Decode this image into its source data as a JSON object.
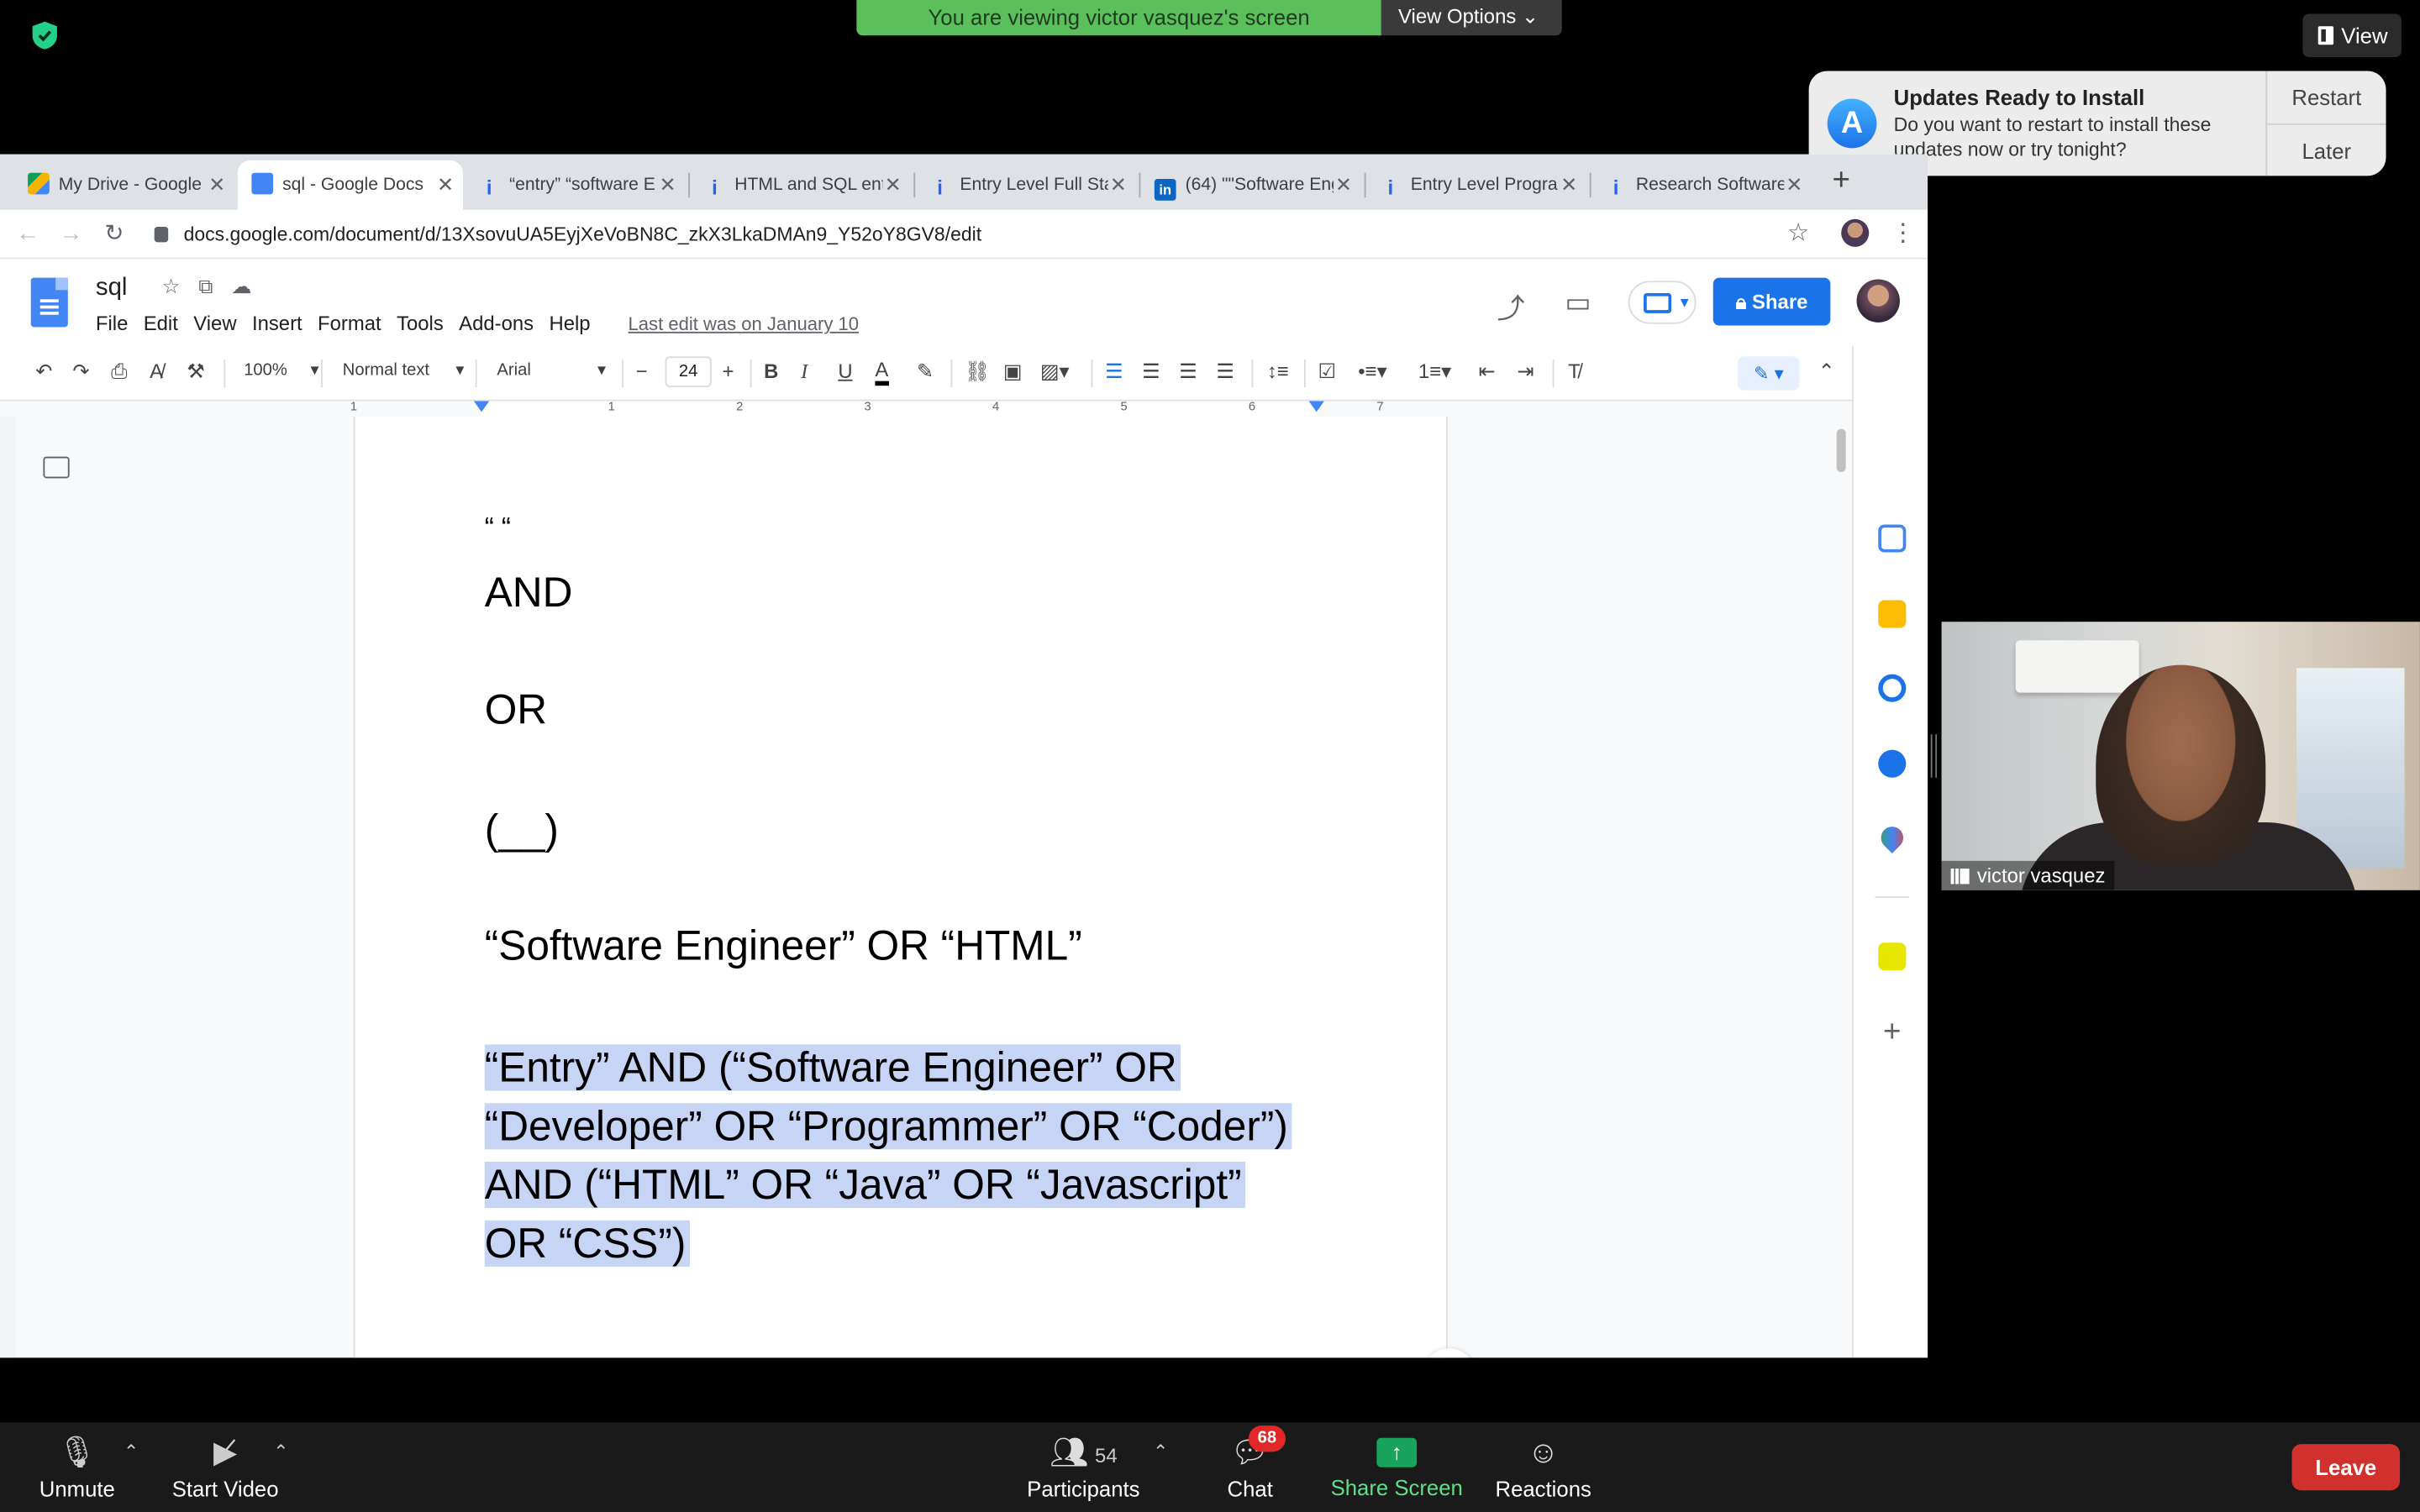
{
  "zoom": {
    "banner_text": "You are viewing victor vasquez's screen",
    "view_options_label": "View Options",
    "view_button_label": "View",
    "notification": {
      "title": "Updates Ready to Install",
      "body": "Do you want to restart to install these updates now or try tonight?",
      "restart_label": "Restart",
      "later_label": "Later"
    },
    "video": {
      "participant_name": "victor vasquez"
    },
    "bottom_bar": {
      "unmute_label": "Unmute",
      "start_video_label": "Start Video",
      "participants_label": "Participants",
      "participants_count": "54",
      "chat_label": "Chat",
      "chat_badge": "68",
      "share_screen_label": "Share Screen",
      "reactions_label": "Reactions",
      "leave_label": "Leave"
    }
  },
  "browser": {
    "tabs": [
      {
        "title": "My Drive - Google D",
        "icon": "drive-icon"
      },
      {
        "title": "sql - Google Docs",
        "icon": "docs-icon",
        "active": true
      },
      {
        "title": "“entry” “software E",
        "icon": "indeed-icon"
      },
      {
        "title": "HTML and SQL ent",
        "icon": "indeed-icon"
      },
      {
        "title": "Entry Level Full Sta",
        "icon": "indeed-icon"
      },
      {
        "title": "(64) \"\"Software Eng",
        "icon": "linkedin-icon"
      },
      {
        "title": "Entry Level Progran",
        "icon": "indeed-icon"
      },
      {
        "title": "Research Software",
        "icon": "indeed-icon"
      }
    ],
    "url": "docs.google.com/document/d/13XsovuUA5EyjXeVoBN8C_zkX3LkaDMAn9_Y52oY8GV8/edit"
  },
  "docs": {
    "title": "sql",
    "menu": [
      "File",
      "Edit",
      "View",
      "Insert",
      "Format",
      "Tools",
      "Add-ons",
      "Help"
    ],
    "last_edit": "Last edit was on January 10",
    "share_label": "Share",
    "toolbar": {
      "zoom": "100%",
      "style": "Normal text",
      "font": "Arial",
      "font_size": "24"
    },
    "ruler_numbers": [
      "1",
      "1",
      "2",
      "3",
      "4",
      "5",
      "6",
      "7"
    ],
    "content": {
      "quotes": "“ “",
      "and": "AND",
      "or": "OR",
      "parens": "(__)",
      "example": "“Software Engineer” OR “HTML”",
      "selected_lines": [
        "“Entry” AND (“Software Engineer” OR",
        "“Developer” OR “Programmer” OR “Coder”)",
        "AND (“HTML” OR “Java” OR “Javascript”",
        "OR “CSS”)"
      ]
    }
  },
  "colors": {
    "zoom_green": "#5bc05b",
    "docs_blue": "#1a73e8",
    "selection": "#c6d5f6",
    "leave_red": "#d0312d"
  }
}
